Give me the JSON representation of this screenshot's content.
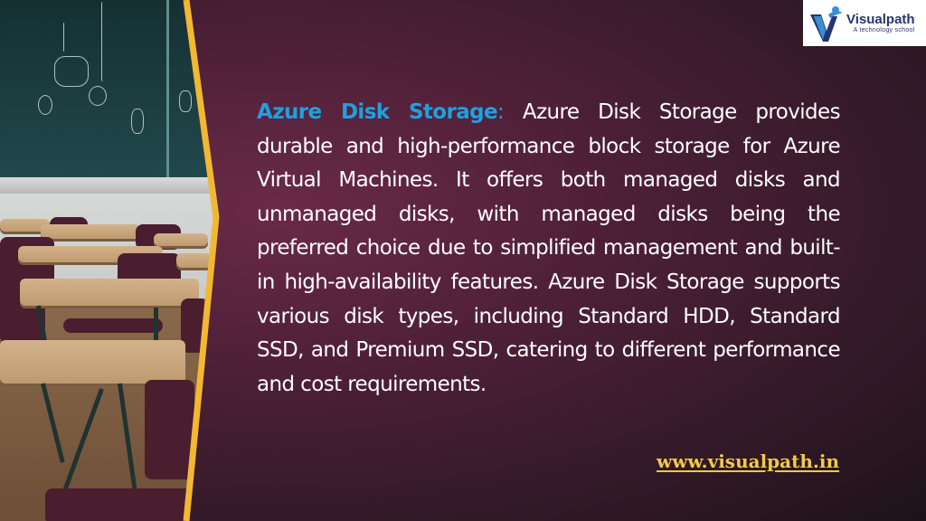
{
  "slide": {
    "background_colors": [
      "#6a2a48",
      "#341a28",
      "#1e1219"
    ],
    "accent_border_color": "#f2b733"
  },
  "photo": {
    "subject": "classroom with chalkboard and desks"
  },
  "logo": {
    "name": "Visualpath",
    "tagline": "A technology school",
    "brand_color": "#26356f",
    "accent_color": "#3a8fd6"
  },
  "content": {
    "heading": "Azure Disk Storage",
    "heading_separator": ":",
    "heading_color": "#1ea1e0",
    "body": " Azure Disk Storage provides durable and high-performance block storage for Azure Virtual Machines. It offers both managed disks and unmanaged disks, with managed disks being the preferred choice due to simplified management and built-in high-availability features. Azure Disk Storage supports various disk types, including Standard HDD, Standard SSD, and Premium SSD, catering to different performance and cost requirements."
  },
  "footer": {
    "website": "www.visualpath.in",
    "website_color": "#f2c94c"
  }
}
